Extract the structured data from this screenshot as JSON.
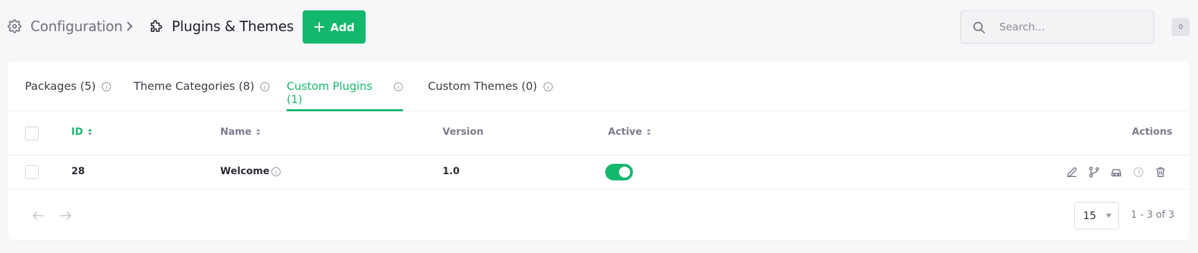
{
  "header": {
    "breadcrumb_root": "Configuration",
    "page_title": "Plugins & Themes",
    "add_label": "Add",
    "search_placeholder": "Search...",
    "notification_count": "0"
  },
  "tabs": [
    {
      "label": "Packages (5)",
      "active": false
    },
    {
      "label": "Theme Categories (8)",
      "active": false
    },
    {
      "label": "Custom Plugins (1)",
      "active": true
    },
    {
      "label": "Custom Themes (0)",
      "active": false
    }
  ],
  "table": {
    "columns": [
      "ID",
      "Name",
      "Version",
      "Active",
      "Actions"
    ],
    "sorted_column": "ID",
    "rows": [
      {
        "id": "28",
        "name": "Welcome",
        "version": "1.0",
        "active": true
      }
    ],
    "row_actions": [
      "edit-icon",
      "branch-icon",
      "car-icon",
      "clock-icon",
      "trash-icon"
    ]
  },
  "pagination": {
    "per_page": "15",
    "range": "1 - 3 of 3"
  },
  "colors": {
    "accent": "#14b86c",
    "background": "#f7f7f9",
    "muted_text": "#7b7b8c"
  }
}
